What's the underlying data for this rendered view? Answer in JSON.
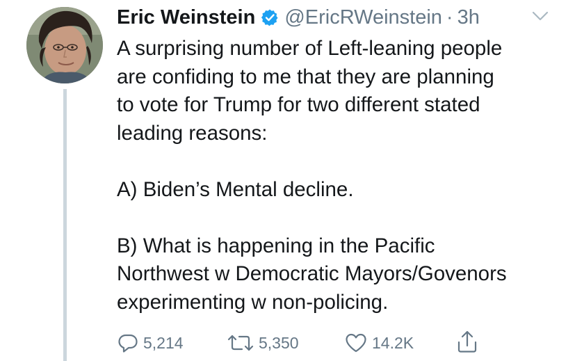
{
  "tweet": {
    "author_name": "Eric Weinstein",
    "handle": "@EricRWeinstein",
    "separator": "·",
    "time": "3h",
    "body_lines": [
      "A surprising number of Left-leaning people",
      "are confiding to me that they are planning",
      "to vote for Trump for two different stated",
      "leading reasons:",
      "",
      "A) Biden’s Mental decline.",
      "",
      "B) What is happening in the Pacific",
      "Northwest w Democratic Mayors/Govenors",
      "experimenting w non-policing."
    ]
  },
  "actions": {
    "reply_count": "5,214",
    "retweet_count": "5,350",
    "like_count": "14.2K"
  },
  "icons": {
    "verified": "verified-badge-icon",
    "caret": "chevron-down-icon",
    "reply": "reply-icon",
    "retweet": "retweet-icon",
    "like": "heart-icon",
    "share": "share-icon"
  },
  "colors": {
    "accent": "#1da1f2",
    "secondary_text": "#657786",
    "primary_text": "#14171a",
    "thread_line": "#ccd6dd"
  }
}
